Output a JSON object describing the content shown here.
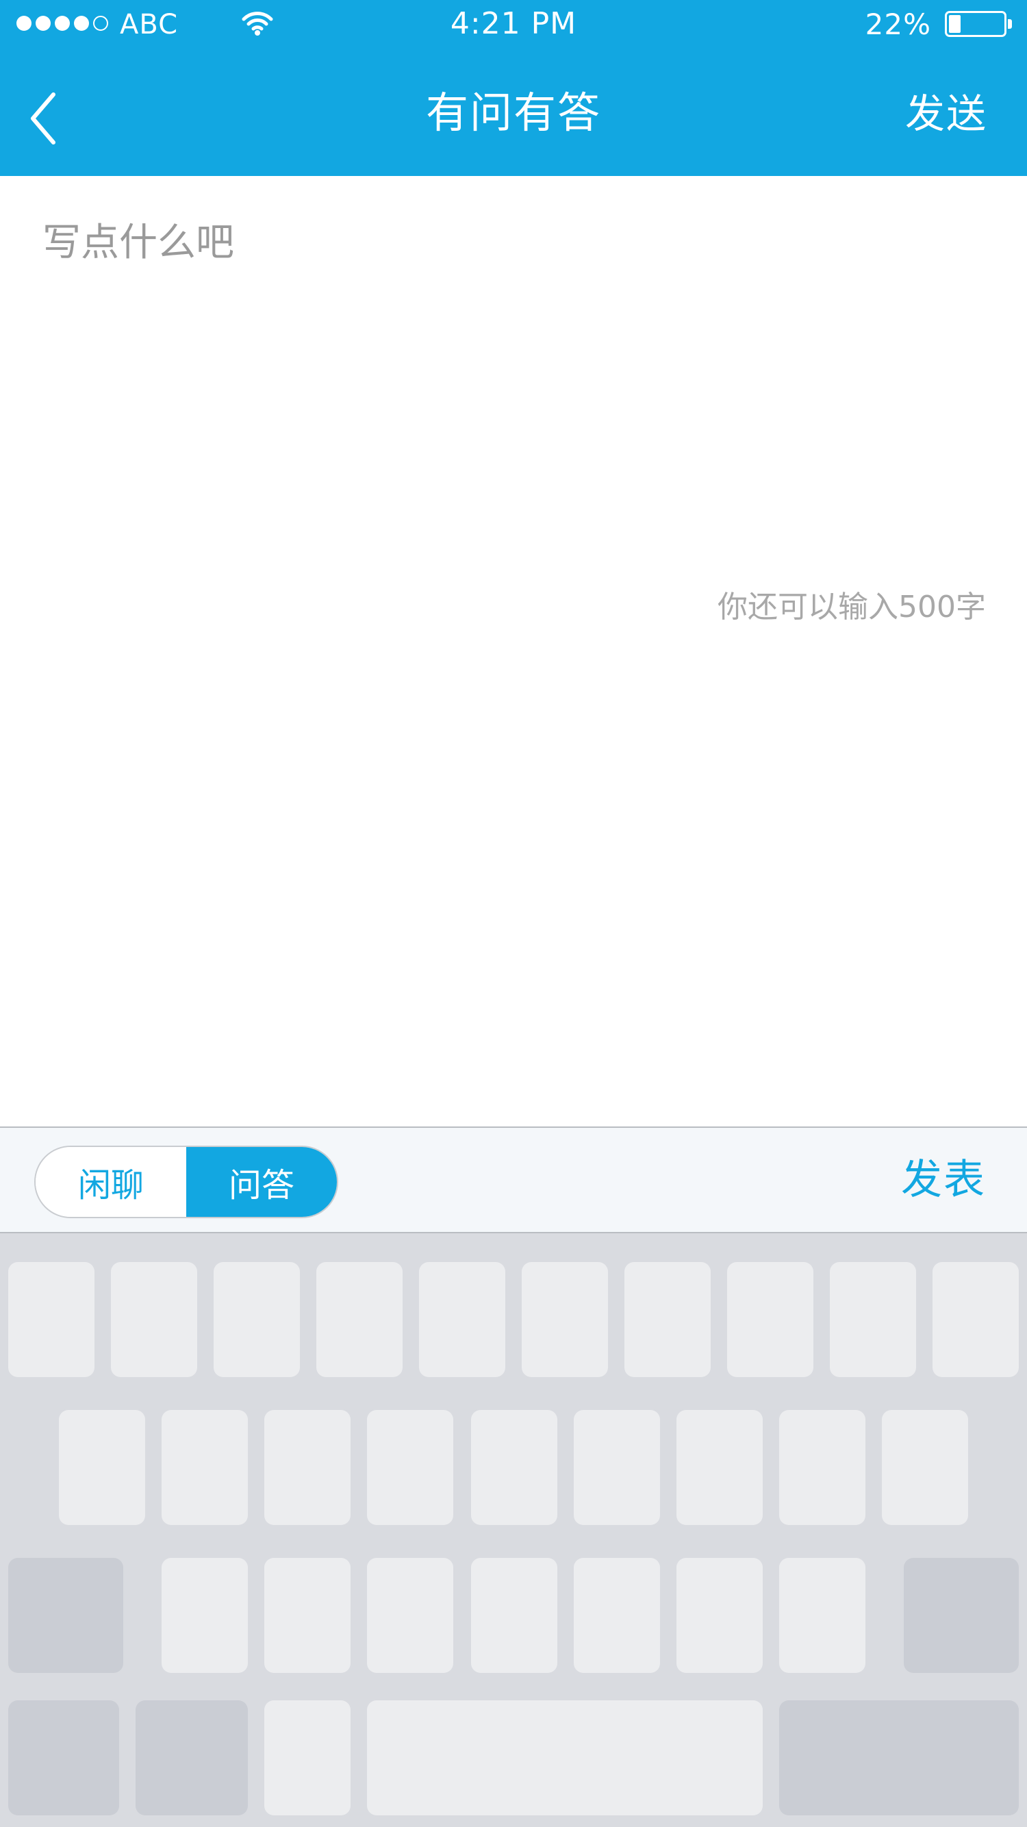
{
  "status_bar": {
    "signal_strength": 4,
    "signal_max": 5,
    "carrier": "ABC",
    "time": "4:21 PM",
    "battery_percent": "22%",
    "battery_level": 0.22,
    "icons": [
      "signal-dots-icon",
      "wifi-icon",
      "battery-icon"
    ]
  },
  "nav": {
    "back_icon": "chevron-left-icon",
    "title": "有问有答",
    "send_label": "发送"
  },
  "compose": {
    "placeholder": "写点什么吧",
    "value": "",
    "counter": "你还可以输入500字"
  },
  "toolbar": {
    "segments": [
      {
        "label": "闲聊",
        "selected": false
      },
      {
        "label": "问答",
        "selected": true
      }
    ],
    "publish_label": "发表"
  },
  "keyboard": {
    "rows": 4,
    "row1_keys": 10,
    "row2_keys": 9,
    "row3_keys": 9,
    "row4_keys": 5
  },
  "colors": {
    "accent": "#12a7e1",
    "toolbar_bg": "#f4f7fa",
    "keyboard_bg": "#d9dbe0",
    "key": "#ecedef",
    "key_modifier": "#cacdd4",
    "placeholder": "#9a9a9a",
    "counter": "#a8a8a8"
  }
}
